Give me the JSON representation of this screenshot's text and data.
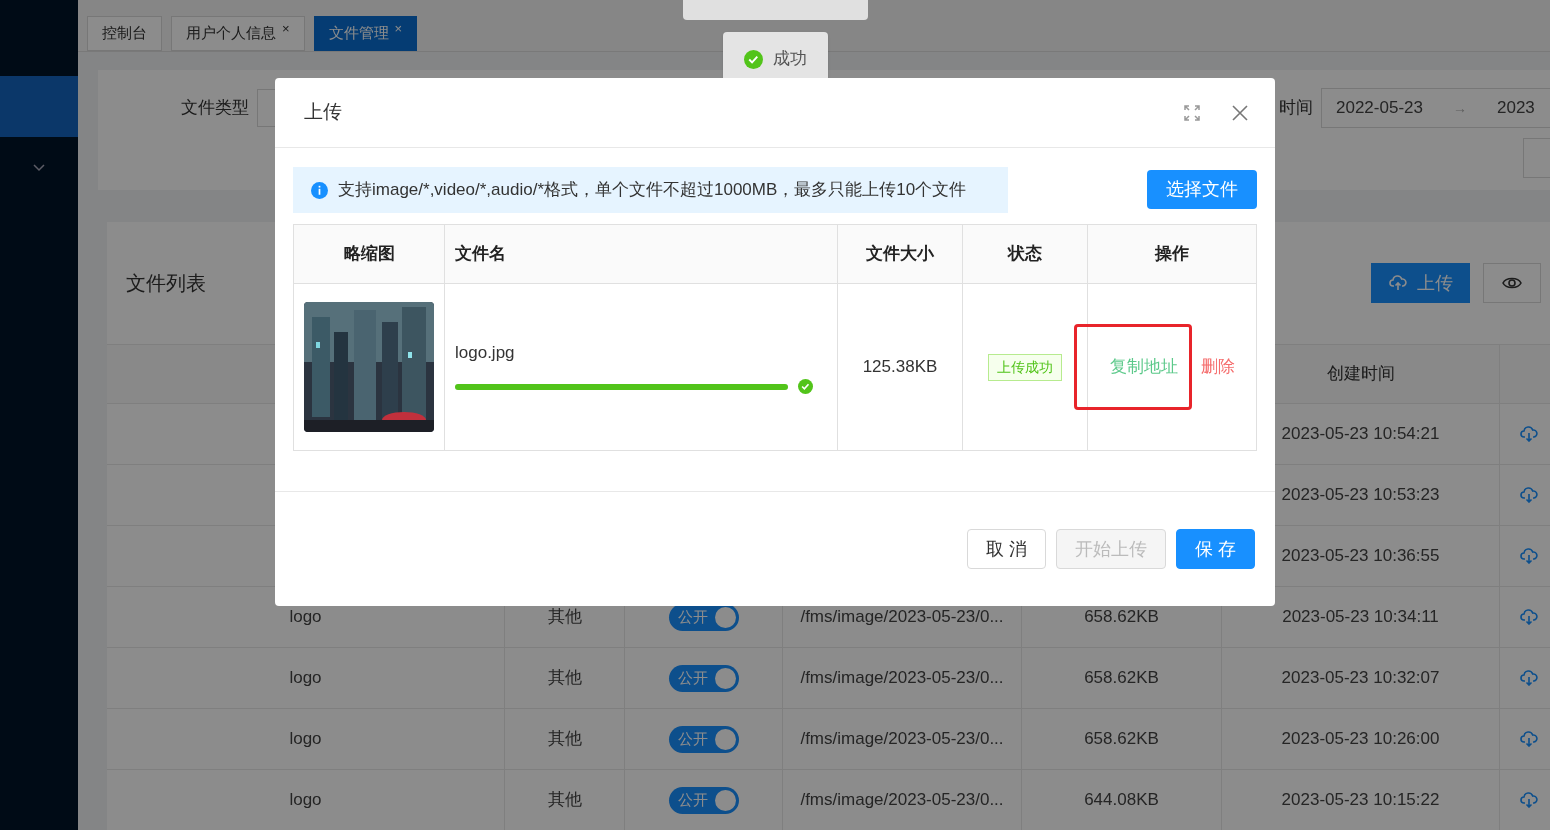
{
  "sidebar": {
    "items": [
      {
        "selected": true,
        "expandable": false
      },
      {
        "selected": false,
        "expandable": true
      }
    ]
  },
  "tabs": [
    {
      "label": "控制台",
      "selected": false,
      "closable": false
    },
    {
      "label": "用户个人信息",
      "selected": false,
      "closable": true,
      "close": "×"
    },
    {
      "label": "文件管理",
      "selected": true,
      "closable": true,
      "close": "×"
    }
  ],
  "filters": {
    "file_type_label": "文件类型",
    "date_label": "时间",
    "date_start": "2022-05-23",
    "date_arrow": "→",
    "date_end": "2023"
  },
  "file_list": {
    "title": "文件列表",
    "upload_button": "上传",
    "table": {
      "time_header": "创建时间",
      "rows": [
        {
          "created": "2023-05-23 10:54:21"
        },
        {
          "created": "2023-05-23 10:53:23"
        },
        {
          "created": "2023-05-23 10:36:55"
        },
        {
          "name": "logo",
          "type": "其他",
          "public": {
            "label": "公开",
            "on": true
          },
          "path": "/fms/image/2023-05-23/0...",
          "size": "658.62KB",
          "created": "2023-05-23 10:34:11"
        },
        {
          "name": "logo",
          "type": "其他",
          "public": {
            "label": "公开",
            "on": true
          },
          "path": "/fms/image/2023-05-23/0...",
          "size": "658.62KB",
          "created": "2023-05-23 10:32:07"
        },
        {
          "name": "logo",
          "type": "其他",
          "public": {
            "label": "公开",
            "on": true
          },
          "path": "/fms/image/2023-05-23/0...",
          "size": "658.62KB",
          "created": "2023-05-23 10:26:00"
        },
        {
          "name": "logo",
          "type": "其他",
          "public": {
            "label": "公开",
            "on": true
          },
          "path": "/fms/image/2023-05-23/0...",
          "size": "644.08KB",
          "created": "2023-05-23 10:15:22"
        }
      ]
    }
  },
  "toasts": [
    {
      "kind": "loading"
    },
    {
      "kind": "success",
      "text": "成功"
    }
  ],
  "dialog": {
    "title": "上传",
    "alert": "支持image/*,video/*,audio/*格式，单个文件不超过1000MB，最多只能上传10个文件",
    "select_button": "选择文件",
    "columns": [
      "略缩图",
      "文件名",
      "文件大小",
      "状态",
      "操作"
    ],
    "rows": [
      {
        "thumbnail": {
          "kind": "picture"
        },
        "file_name": "logo.jpg",
        "level": 1,
        "done": true,
        "size": "125.38KB",
        "status": "上传成功",
        "actions": [
          {
            "kind": "copy",
            "label": "复制地址",
            "highlighted": true
          },
          {
            "kind": "delete",
            "label": "删除"
          }
        ]
      }
    ],
    "buttons": [
      {
        "kind": "default",
        "label": "取 消",
        "disabled": false
      },
      {
        "kind": "default",
        "label": "开始上传",
        "disabled": true
      },
      {
        "kind": "primary",
        "label": "保 存",
        "disabled": false
      }
    ]
  }
}
